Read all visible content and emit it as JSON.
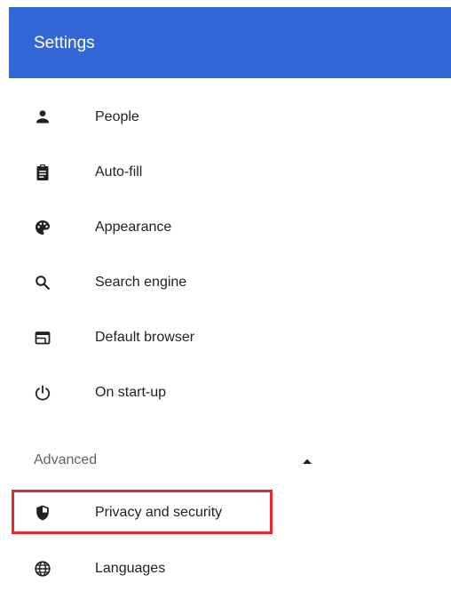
{
  "header": {
    "title": "Settings",
    "background_color": "#3367d6"
  },
  "nav": {
    "items": [
      {
        "label": "People",
        "icon": "person-icon"
      },
      {
        "label": "Auto-fill",
        "icon": "clipboard-icon"
      },
      {
        "label": "Appearance",
        "icon": "palette-icon"
      },
      {
        "label": "Search engine",
        "icon": "search-icon"
      },
      {
        "label": "Default browser",
        "icon": "browser-window-icon"
      },
      {
        "label": "On start-up",
        "icon": "power-icon"
      }
    ],
    "advanced": {
      "label": "Advanced",
      "icon": "triangle-up-icon",
      "expanded": true
    },
    "advanced_items": [
      {
        "label": "Privacy and security",
        "icon": "shield-icon",
        "highlighted": true
      },
      {
        "label": "Languages",
        "icon": "globe-icon"
      }
    ]
  },
  "colors": {
    "accent": "#3367d6",
    "highlight_border": "#e8262d",
    "text": "#202124",
    "icon": "#202124",
    "muted_text": "#5f6368"
  }
}
